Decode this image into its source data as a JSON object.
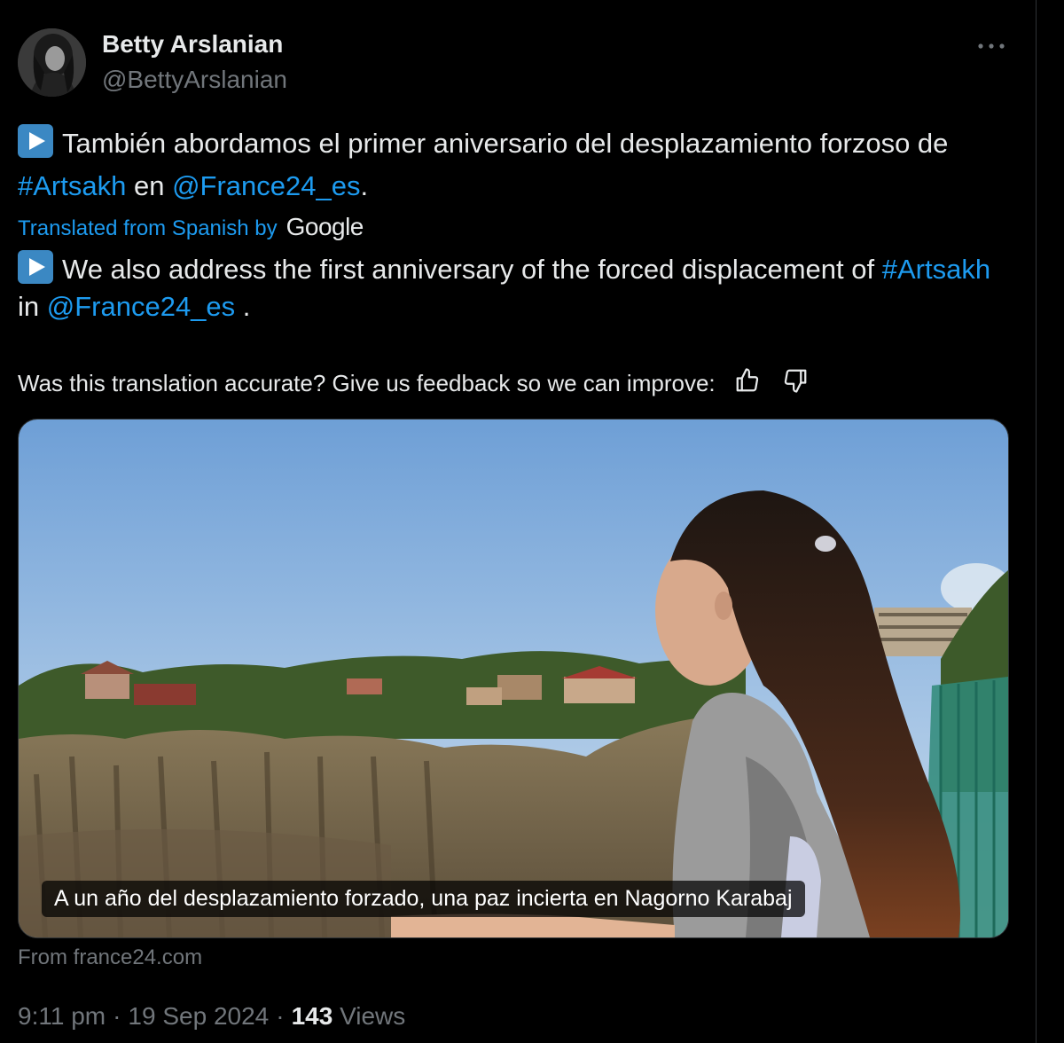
{
  "author": {
    "name": "Betty Arslanian",
    "handle": "@BettyArslanian"
  },
  "tweet": {
    "original": {
      "text_1": "También abordamos el primer aniversario del desplazamiento forzoso de ",
      "hashtag": "#Artsakh",
      "text_2": " en ",
      "mention": "@France24_es",
      "text_3": "."
    },
    "translated_label": "Translated from Spanish by",
    "translated_provider": "Google",
    "translation": {
      "text_1": "We also address the first anniversary of the forced displacement of ",
      "hashtag": "#Artsakh",
      "text_2": " in ",
      "mention": "@France24_es",
      "text_3": " ."
    },
    "feedback_prompt": "Was this translation accurate? Give us feedback so we can improve:",
    "emoji_icon": "play-button-emoji"
  },
  "media": {
    "caption": "A un año del desplazamiento forzado, una paz incierta en Nagorno Karabaj",
    "source": "From france24.com"
  },
  "meta": {
    "time": "9:11 pm",
    "separator": "·",
    "date": "19 Sep 2024",
    "views_count": "143",
    "views_label": "Views"
  },
  "colors": {
    "background": "#000000",
    "text": "#e7e9ea",
    "secondary": "#71767b",
    "link": "#1d9bf0",
    "emoji": "#3b88c3"
  },
  "icons": [
    "more-icon",
    "thumbs-up-icon",
    "thumbs-down-icon",
    "play-button-emoji"
  ]
}
